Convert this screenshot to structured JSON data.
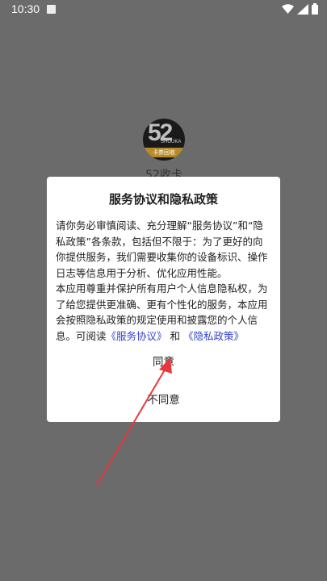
{
  "status_bar": {
    "time": "10:30",
    "icons": [
      "notification-icon",
      "wifi-icon",
      "signal-icon",
      "battery-icon"
    ]
  },
  "app": {
    "logo_number": "52",
    "logo_subtext": "SHOUKA",
    "logo_band_text": "卡券回收",
    "name": "52收卡"
  },
  "dialog": {
    "title": "服务协议和隐私政策",
    "paragraph1": "请你务必审慎阅读、充分理解“服务协议”和“隐私政策”各条款，包括但不限于：为了更好的向你提供服务，我们需要收集你的设备标识、操作日志等信息用于分析、优化应用性能。",
    "paragraph2_lead": "本应用尊重并保护所有用户个人信息隐私权，为了给您提供更准确、更有个性化的服务，本应用会按照隐私政策的规定使用和披露您的个人信息。可阅读",
    "link_service": "《服务协议》",
    "conjunction": "和",
    "link_privacy": "《隐私政策》",
    "agree_label": "同意",
    "disagree_label": "不同意"
  },
  "colors": {
    "overlay": "#6b6b6b",
    "link": "#3344cc",
    "annotation_arrow": "#e8383d"
  }
}
